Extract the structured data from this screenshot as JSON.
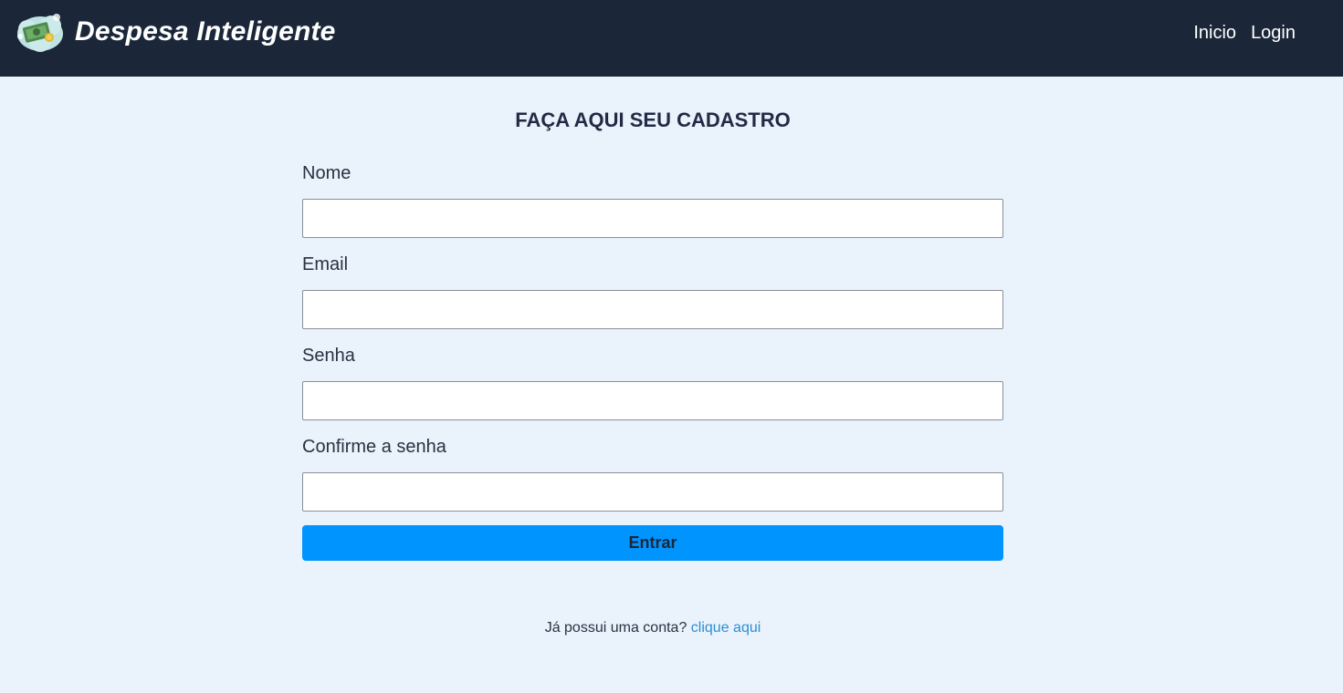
{
  "header": {
    "brand_name": "Despesa Inteligente",
    "logo_icon": "money-cloud-icon",
    "nav": {
      "home_label": "Inicio",
      "login_label": "Login"
    }
  },
  "form": {
    "title": "FAÇA AQUI SEU CADASTRO",
    "fields": [
      {
        "label": "Nome",
        "value": "",
        "type": "text"
      },
      {
        "label": "Email",
        "value": "",
        "type": "email"
      },
      {
        "label": "Senha",
        "value": "",
        "type": "password"
      },
      {
        "label": "Confirme a senha",
        "value": "",
        "type": "password"
      }
    ],
    "submit_label": "Entrar"
  },
  "footer": {
    "prompt_text": "Já possui uma conta?",
    "link_text": "clique aqui"
  },
  "colors": {
    "navbar_bg": "#1b2739",
    "page_bg": "#eaf2fb",
    "button_bg": "#0094ff",
    "link": "#2a8fd4"
  }
}
